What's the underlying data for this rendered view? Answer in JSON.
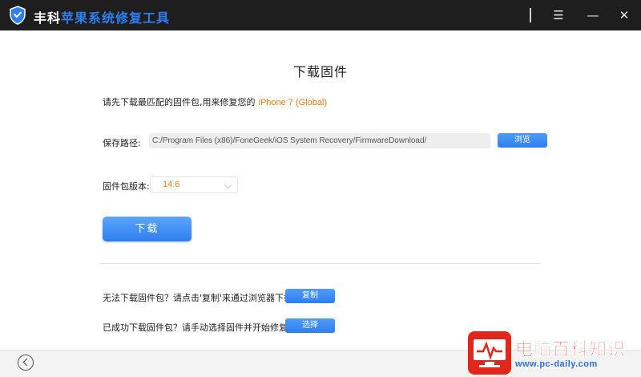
{
  "app": {
    "title_part1": "丰科",
    "title_part2": "苹果系统修复工具",
    "accent_color": "#2f7ef4",
    "titlebar_color": "#1e1e1e"
  },
  "window_controls": {
    "menu": "☰",
    "minimize": "—",
    "close": "✕"
  },
  "page": {
    "title": "下载固件",
    "intro_text": "请先下载最匹配的固件包,用来修复您的",
    "device_model": "iPhone 7 (Global)",
    "highlight_color": "#f07b18"
  },
  "save_path": {
    "label": "保存路径:",
    "value": "C:/Program Files (x86)/FoneGeek/iOS System Recovery/FirmwareDownload/",
    "browse_label": "浏览"
  },
  "firmware_version": {
    "label": "固件包版本:",
    "selected": "14.6"
  },
  "download_button": "下载",
  "help": {
    "copy_hint": "无法下载固件包？请点击'复制'来通过浏览器下载",
    "copy_label": "复制",
    "select_hint": "已成功下载固件包？请手动选择固件并开始修复",
    "select_label": "选择"
  },
  "watermark": {
    "title": "电脑百科知识",
    "url": "www.pc-daily.com"
  }
}
